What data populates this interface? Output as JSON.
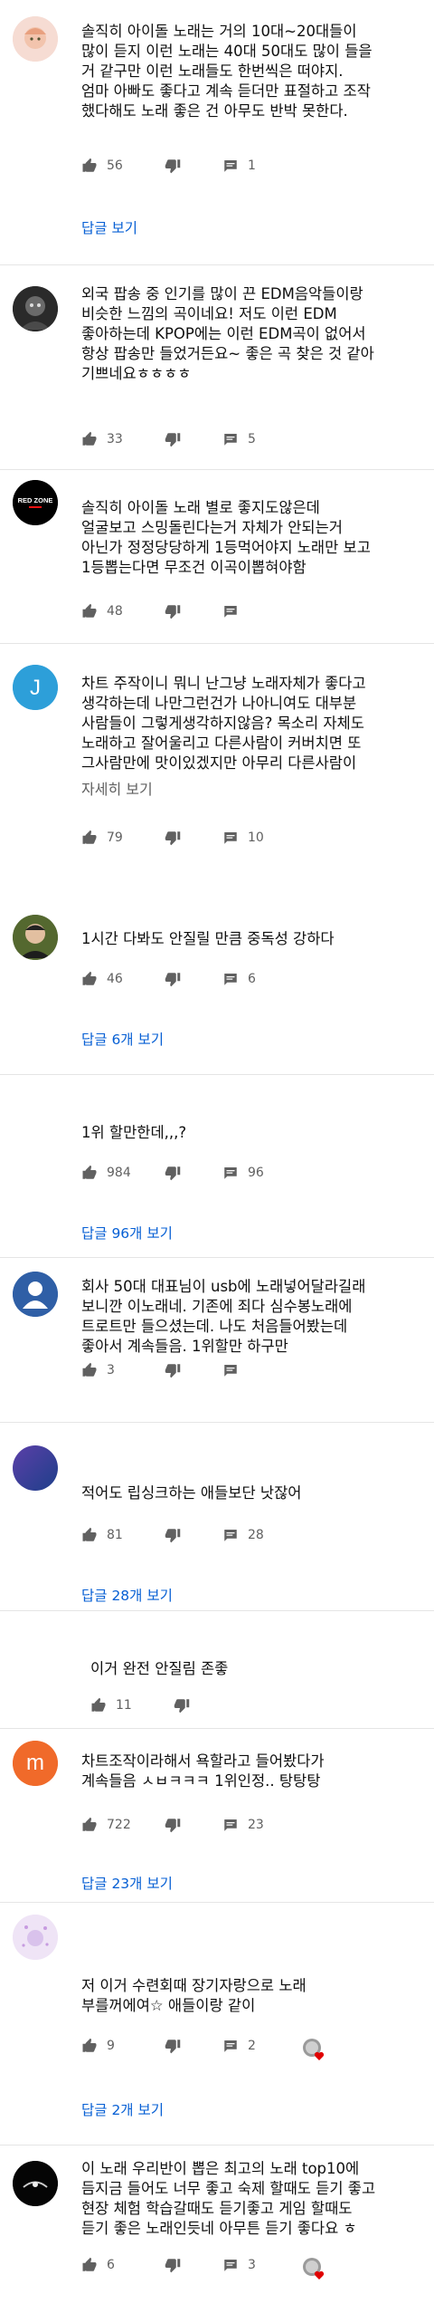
{
  "icons": {
    "like": "thumb-up-icon",
    "dislike": "thumb-down-icon",
    "reply": "reply-icon",
    "creator_heart": "creator-heart-icon"
  },
  "colors": {
    "link": "#065fd4",
    "meta": "#606060",
    "text": "#0f0f0f",
    "heart": "#e00000",
    "avatar_j": "#2d9fd9",
    "avatar_m": "#f06a2a"
  },
  "comments": [
    {
      "text": "솔직히 아이돌 노래는 거의 10대~20대들이\n많이 듣지 이런 노래는 40대 50대도 많이 들을\n거 같구만 이런 노래들도 한번씩은 떠야지.\n엄마 아빠도 좋다고 계속 듣더만 표절하고 조작\n했다해도 노래 좋은 건 아무도 반박 못한다.",
      "likes": "56",
      "replies": "1",
      "reply_link": "답글 보기"
    },
    {
      "text": "외국 팝송 중 인기를 많이 끈 EDM음악들이랑\n비슷한 느낌의 곡이네요! 저도 이런 EDM\n좋아하는데 KPOP에는 이런 EDM곡이 없어서\n항상 팝송만 들었거든요~ 좋은 곡 찾은 것 같아\n기쁘네요ㅎㅎㅎㅎ",
      "likes": "33",
      "replies": "5"
    },
    {
      "text": "솔직히 아이돌 노래 별로 좋지도않은데\n얼굴보고 스밍돌린다는거 자체가 안되는거\n아닌가 정정당당하게 1등먹어야지 노래만 보고\n1등뽑는다면 무조건 이곡이뽑혀야함",
      "likes": "48",
      "avatar_text": "RED ZONE"
    },
    {
      "text": "차트 주작이니 뭐니 난그냥 노래자체가 좋다고\n생각하는데 나만그런건가 나아니여도 대부분\n사람들이 그렇게생각하지않음? 목소리 자체도\n노래하고 잘어울리고 다른사람이 커버치면 또\n그사람만에 맛이있겠지만 아무리 다른사람이",
      "more": "자세히 보기",
      "likes": "79",
      "replies": "10",
      "avatar_letter": "J"
    },
    {
      "text": "1시간 다봐도 안질릴 만큼 중독성 강하다",
      "likes": "46",
      "replies": "6",
      "reply_link": "답글 6개 보기"
    },
    {
      "text": "1위 할만한데,,,?",
      "likes": "984",
      "replies": "96",
      "reply_link": "답글 96개 보기"
    },
    {
      "text": "회사 50대 대표님이 usb에 노래넣어달라길래\n보니깐 이노래네. 기존에 죄다 심수봉노래에\n트로트만 들으셨는데. 나도 처음들어봤는데\n좋아서 계속들음. 1위할만 하구만",
      "likes": "3"
    },
    {
      "text": "적어도 립싱크하는 애들보단 낫잖어",
      "likes": "81",
      "replies": "28",
      "reply_link": "답글 28개 보기"
    },
    {
      "text": "이거 완전 안질림 존좋",
      "likes": "11"
    },
    {
      "text": "차트조작이라해서 욕할라고 들어봤다가\n계속들음 ㅅㅂㅋㅋㅋ 1위인정.. 탕탕탕",
      "likes": "722",
      "replies": "23",
      "reply_link": "답글 23개 보기",
      "avatar_letter": "m"
    },
    {
      "text": "저 이거 수련회때 장기자랑으로 노래\n부를꺼에여☆ 애들이랑 같이",
      "likes": "9",
      "replies": "2",
      "reply_link": "답글 2개 보기"
    },
    {
      "text": "이 노래 우리반이 뽑은 최고의 노래 top10에\n듬지금 들어도 너무 좋고 숙제 할때도 듣기 좋고\n현장 체험 학습갈때도 듣기좋고 게임 할때도\n듣기 좋은 노래인듯네 아무튼 듣기 좋다요 ㅎ",
      "likes": "6",
      "replies": "3"
    }
  ]
}
